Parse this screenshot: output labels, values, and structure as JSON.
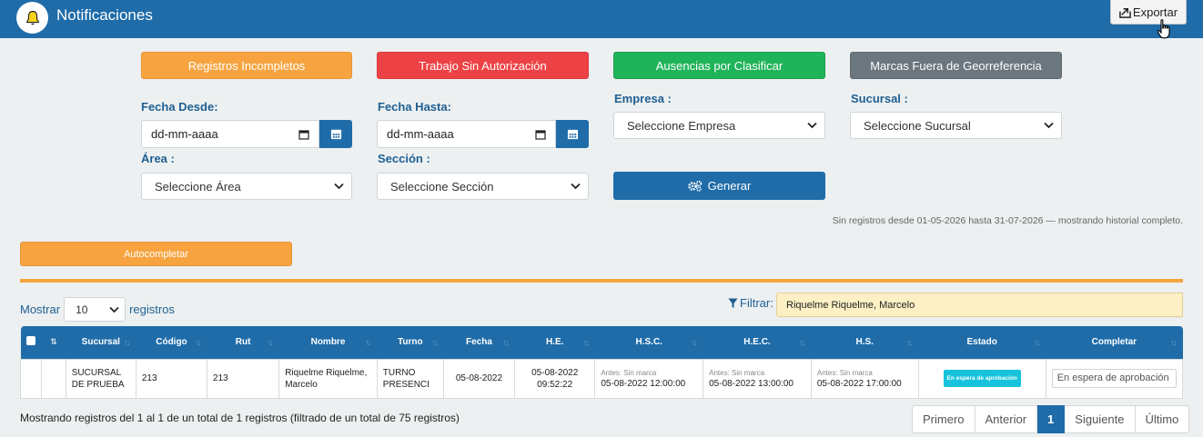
{
  "header": {
    "title": "Notificaciones",
    "export_label": "Exportar",
    "brand_color": "#1f6ca9"
  },
  "filter_buttons": {
    "incompletos": "Registros Incompletos",
    "sin_autorizacion": "Trabajo Sin Autorización",
    "ausencias": "Ausencias por Clasificar",
    "georreferencia": "Marcas Fuera de Georreferencia"
  },
  "form": {
    "fecha_desde_label": "Fecha Desde:",
    "fecha_desde_value": "dd-mm-aaaa",
    "fecha_hasta_label": "Fecha Hasta:",
    "fecha_hasta_value": "dd-mm-aaaa",
    "empresa_label": "Empresa :",
    "empresa_value": "Seleccione Empresa",
    "sucursal_label": "Sucursal :",
    "sucursal_value": "Seleccione Sucursal",
    "area_label": "Área :",
    "area_value": "Seleccione Área",
    "seccion_label": "Sección :",
    "seccion_value": "Seleccione Sección",
    "generar_label": "Generar"
  },
  "notice": "Sin registros desde 01-05-2026 hasta 31-07-2026 — mostrando historial completo.",
  "autocompletar_label": "Autocompletar",
  "length": {
    "prefix": "Mostrar",
    "value": "10",
    "suffix": "registros"
  },
  "filter": {
    "label": "Filtrar:",
    "value": "Riquelme Riquelme, Marcelo"
  },
  "table": {
    "columns": [
      "Sucursal",
      "Código",
      "Rut",
      "Nombre",
      "Turno",
      "Fecha",
      "H.E.",
      "H.S.C.",
      "H.E.C.",
      "H.S.",
      "Estado",
      "Completar"
    ],
    "rows": [
      {
        "sucursal": "SUCURSAL DE PRUEBA",
        "codigo": "213",
        "rut": "213",
        "nombre": "Riquelme Riquelme, Marcelo",
        "turno": "TURNO PRESENCI",
        "fecha": "05-08-2022",
        "he": "05-08-2022 09:52:22",
        "hsc_note": "Antes: Sin marca",
        "hsc": "05-08-2022 12:00:00",
        "hec_note": "Antes: Sin marca",
        "hec": "05-08-2022 13:00:00",
        "hs_note": "Antes: Sin marca",
        "hs": "05-08-2022 17:00:00",
        "estado": "En espera de aprobación",
        "completar": "En espera de aprobación"
      }
    ]
  },
  "info": "Mostrando registros del 1 al 1 de un total de 1 registros (filtrado de un total de 75 registros)",
  "pagination": {
    "first": "Primero",
    "prev": "Anterior",
    "current": "1",
    "next": "Siguiente",
    "last": "Último"
  }
}
